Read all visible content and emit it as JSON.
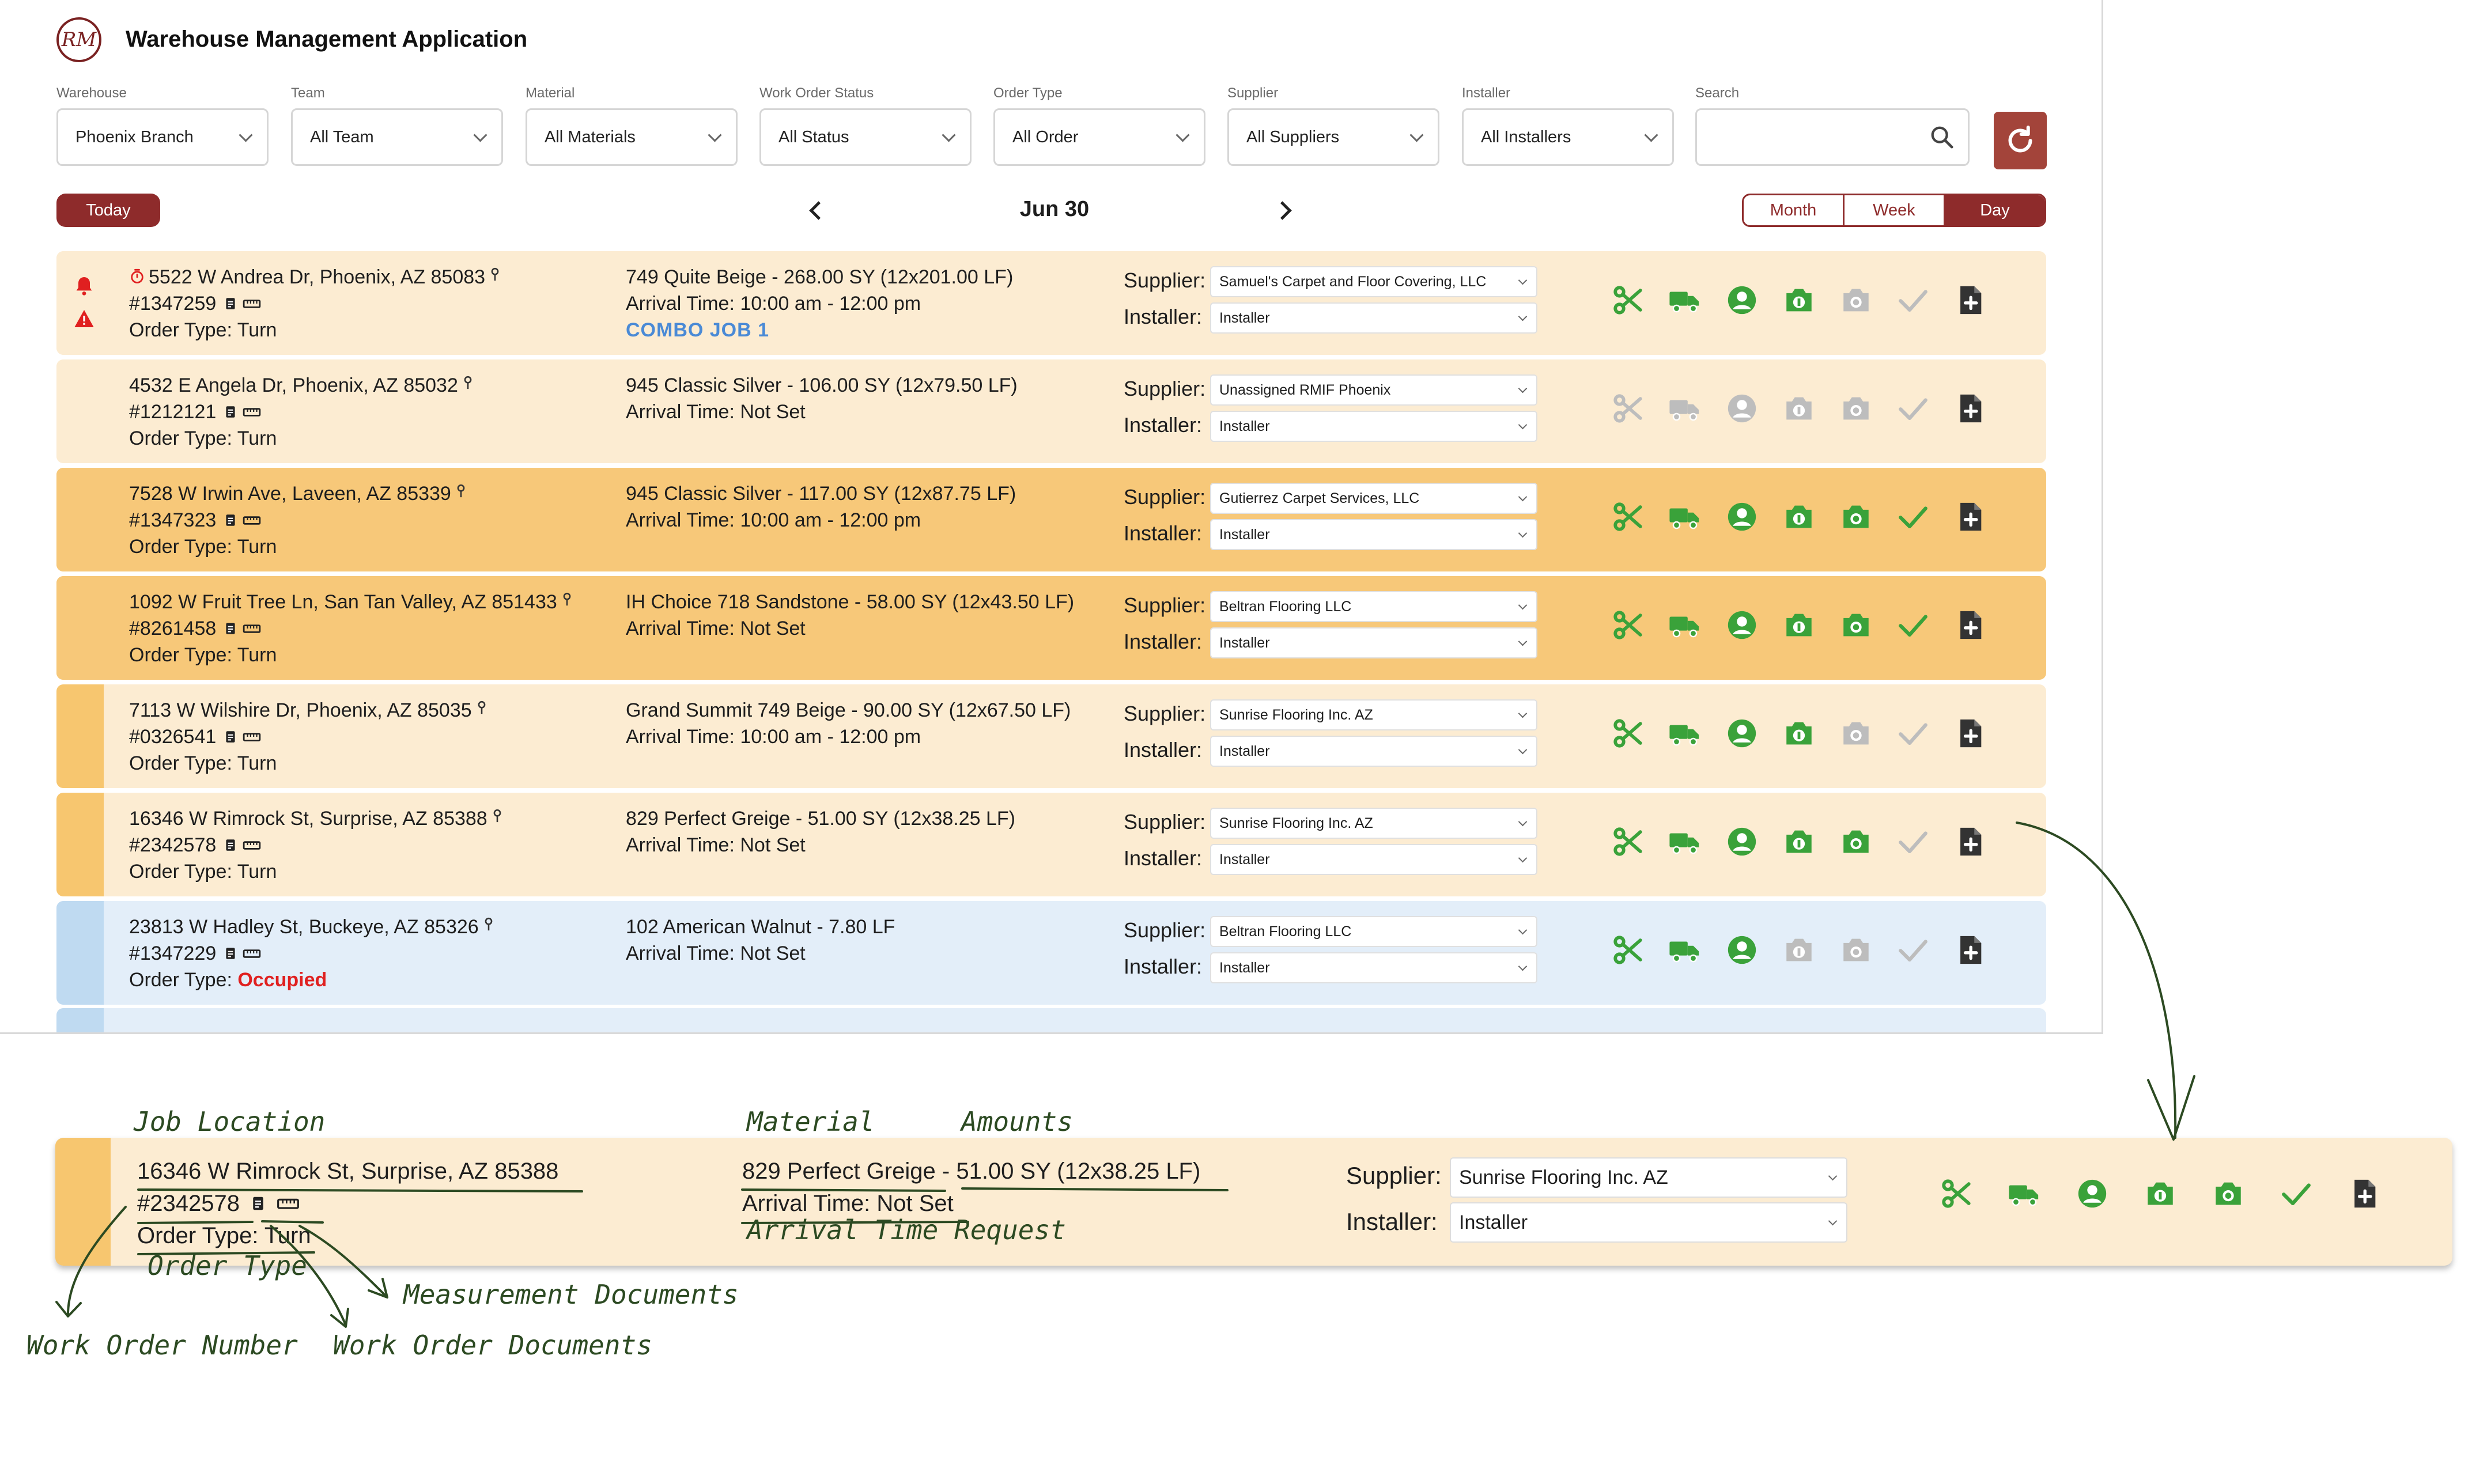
{
  "app": {
    "title": "Warehouse Management Application",
    "logo_text": "RM"
  },
  "filters": [
    {
      "label": "Warehouse",
      "value": "Phoenix Branch"
    },
    {
      "label": "Team",
      "value": "All Team"
    },
    {
      "label": "Material",
      "value": "All Materials"
    },
    {
      "label": "Work Order Status",
      "value": "All Status"
    },
    {
      "label": "Order Type",
      "value": "All Order"
    },
    {
      "label": "Supplier",
      "value": "All Suppliers"
    },
    {
      "label": "Installer",
      "value": "All Installers"
    }
  ],
  "search": {
    "label": "Search",
    "value": ""
  },
  "nav": {
    "today": "Today",
    "date": "Jun 30",
    "views": [
      "Month",
      "Week",
      "Day"
    ],
    "active_view": "Day"
  },
  "field_labels": {
    "supplier": "Supplier:",
    "installer": "Installer:"
  },
  "colors": {
    "brand": "#8e2b2b",
    "green": "#3aa23a",
    "grey": "#bdbdbd",
    "row_light": "#fcecd2",
    "row_dark": "#f7c879",
    "row_blue": "#e3eef9",
    "stripe_orange": "#f7c66f",
    "stripe_blue": "#bfdaf1",
    "alert_red": "#e02020"
  },
  "icon_names": [
    "scissors-icon",
    "truck-icon",
    "installer-icon",
    "money-photo-icon",
    "camera-icon",
    "check-icon",
    "add-document-icon"
  ],
  "rows": [
    {
      "address": "5522 W Andrea Dr, Phoenix, AZ 85083",
      "order_number": "#1347259",
      "order_type_label": "Order Type:",
      "order_type": "Turn",
      "material": "749 Quite Beige - 268.00 SY (12x201.00 LF)",
      "arrival": "Arrival Time: 10:00 am - 12:00 pm",
      "extra": "COMBO JOB 1",
      "supplier": "Samuel's Carpet and Floor Covering, LLC",
      "installer": "Installer",
      "icons_on": [
        true,
        true,
        true,
        true,
        false,
        false,
        true
      ]
    },
    {
      "address": "4532 E Angela Dr, Phoenix, AZ 85032",
      "order_number": "#1212121",
      "order_type_label": "Order Type:",
      "order_type": "Turn",
      "material": "945 Classic Silver - 106.00 SY (12x79.50 LF)",
      "arrival": "Arrival Time: Not Set",
      "supplier": "Unassigned RMIF Phoenix",
      "installer": "Installer",
      "icons_on": [
        false,
        false,
        false,
        false,
        false,
        false,
        true
      ]
    },
    {
      "address": "7528 W Irwin Ave, Laveen, AZ 85339",
      "order_number": "#1347323",
      "order_type_label": "Order Type:",
      "order_type": "Turn",
      "material": "945 Classic Silver - 117.00 SY (12x87.75 LF)",
      "arrival": "Arrival Time: 10:00 am - 12:00 pm",
      "supplier": "Gutierrez Carpet Services, LLC",
      "installer": "Installer",
      "icons_on": [
        true,
        true,
        true,
        true,
        true,
        true,
        true
      ]
    },
    {
      "address": "1092 W Fruit Tree Ln, San Tan Valley, AZ 851433",
      "order_number": "#8261458",
      "order_type_label": "Order Type:",
      "order_type": "Turn",
      "material": "IH Choice 718 Sandstone - 58.00 SY (12x43.50 LF)",
      "arrival": "Arrival Time: Not Set",
      "supplier": "Beltran Flooring LLC",
      "installer": "Installer",
      "icons_on": [
        true,
        true,
        true,
        true,
        true,
        true,
        true
      ]
    },
    {
      "address": "7113 W Wilshire Dr, Phoenix, AZ 85035",
      "order_number": "#0326541",
      "order_type_label": "Order Type:",
      "order_type": "Turn",
      "material": "Grand Summit 749 Beige - 90.00 SY (12x67.50 LF)",
      "arrival": "Arrival Time: 10:00 am - 12:00 pm",
      "supplier": "Sunrise Flooring Inc. AZ",
      "installer": "Installer",
      "icons_on": [
        true,
        true,
        true,
        true,
        false,
        false,
        true
      ]
    },
    {
      "address": "16346 W Rimrock St, Surprise, AZ 85388",
      "order_number": "#2342578",
      "order_type_label": "Order Type:",
      "order_type": "Turn",
      "material": "829 Perfect Greige - 51.00 SY (12x38.25 LF)",
      "arrival": "Arrival Time: Not Set",
      "supplier": "Sunrise Flooring Inc. AZ",
      "installer": "Installer",
      "icons_on": [
        true,
        true,
        true,
        true,
        true,
        false,
        true
      ]
    },
    {
      "address": "23813 W Hadley St, Buckeye, AZ 85326",
      "order_number": "#1347229",
      "order_type_label": "Order Type:",
      "order_type": "Occupied",
      "material": "102 American Walnut - 7.80 LF",
      "arrival": "Arrival Time: Not Set",
      "supplier": "Beltran Flooring LLC",
      "installer": "Installer",
      "icons_on": [
        true,
        true,
        true,
        false,
        false,
        false,
        true
      ]
    }
  ],
  "zoom": {
    "address": "16346 W Rimrock St, Surprise, AZ 85388",
    "order_number": "#2342578",
    "order_type_line": "Order Type: Turn",
    "material_name": "829 Perfect Greige",
    "separator": "-",
    "amounts": "51.00 SY (12x38.25 LF)",
    "arrival": "Arrival Time: Not Set",
    "supplier": "Sunrise Flooring Inc. AZ",
    "installer": "Installer",
    "annotations": {
      "job_location": "Job Location",
      "material": "Material",
      "amounts": "Amounts",
      "arrival_request": "Arrival Time Request",
      "order_type": "Order Type",
      "measurement_docs": "Measurement Documents",
      "work_order_number": "Work Order Number",
      "work_order_docs": "Work Order Documents"
    }
  }
}
